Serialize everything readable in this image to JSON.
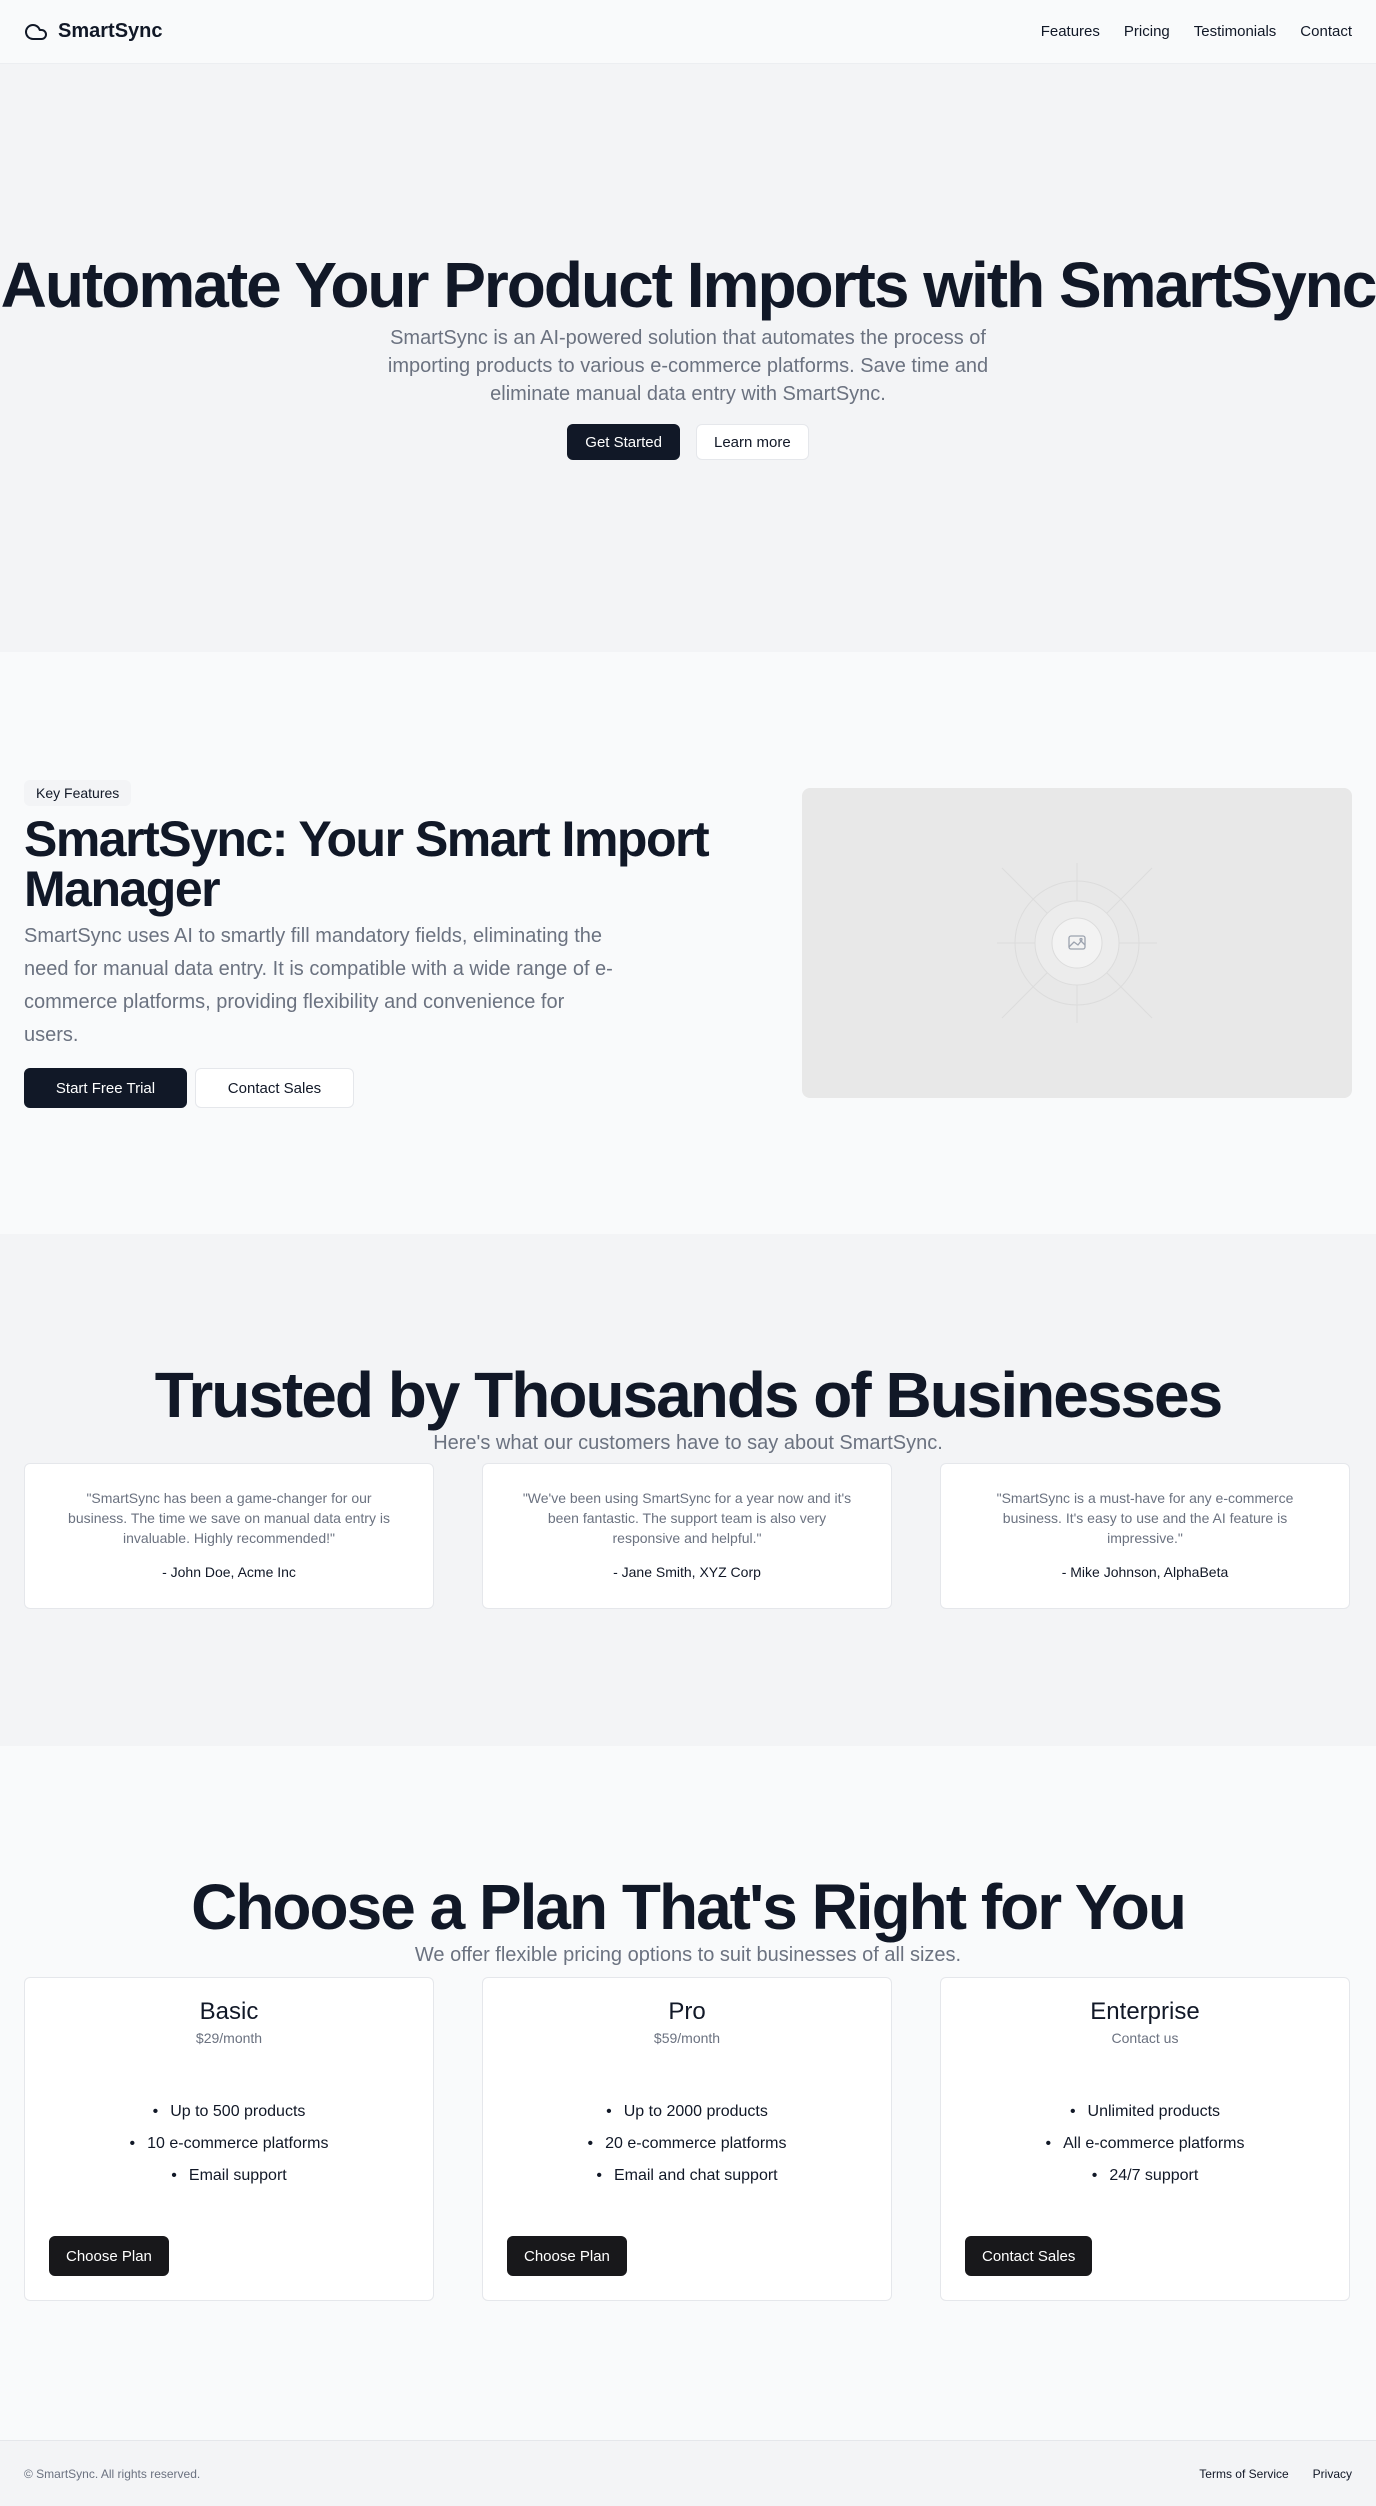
{
  "header": {
    "brand": "SmartSync",
    "nav": [
      "Features",
      "Pricing",
      "Testimonials",
      "Contact"
    ]
  },
  "hero": {
    "title": "Automate Your Product Imports with SmartSync",
    "description": "SmartSync is an AI-powered solution that automates the process of importing products to various e-commerce platforms. Save time and eliminate manual data entry with SmartSync.",
    "primary_button": "Get Started",
    "secondary_button": "Learn more"
  },
  "features": {
    "badge": "Key Features",
    "title": "SmartSync: Your Smart Import Manager",
    "description": "SmartSync uses AI to smartly fill mandatory fields, eliminating the need for manual data entry. It is compatible with a wide range of e-commerce platforms, providing flexibility and convenience for users.",
    "primary_button": "Start Free Trial",
    "secondary_button": "Contact Sales",
    "image_icon": "image-placeholder-icon"
  },
  "testimonials": {
    "title": "Trusted by Thousands of Businesses",
    "subtitle": "Here's what our customers have to say about SmartSync.",
    "items": [
      {
        "quote": "\"SmartSync has been a game-changer for our business. The time we save on manual data entry is invaluable. Highly recommended!\"",
        "author": "- John Doe, Acme Inc"
      },
      {
        "quote": "\"We've been using SmartSync for a year now and it's been fantastic. The support team is also very responsive and helpful.\"",
        "author": "- Jane Smith, XYZ Corp"
      },
      {
        "quote": "\"SmartSync is a must-have for any e-commerce business. It's easy to use and the AI feature is impressive.\"",
        "author": "- Mike Johnson, AlphaBeta"
      }
    ]
  },
  "pricing": {
    "title": "Choose a Plan That's Right for You",
    "subtitle": "We offer flexible pricing options to suit businesses of all sizes.",
    "plans": [
      {
        "name": "Basic",
        "price": "$29/month",
        "features": [
          "Up to 500 products",
          "10 e-commerce platforms",
          "Email support"
        ],
        "button": "Choose Plan"
      },
      {
        "name": "Pro",
        "price": "$59/month",
        "features": [
          "Up to 2000 products",
          "20 e-commerce platforms",
          "Email and chat support"
        ],
        "button": "Choose Plan"
      },
      {
        "name": "Enterprise",
        "price": "Contact us",
        "features": [
          "Unlimited products",
          "All e-commerce platforms",
          "24/7 support"
        ],
        "button": "Contact Sales"
      }
    ]
  },
  "footer": {
    "copyright": "© SmartSync. All rights reserved.",
    "links": [
      "Terms of Service",
      "Privacy"
    ]
  },
  "colors": {
    "primary": "#111827",
    "muted_text": "#6b7280",
    "section_alt_bg": "#f3f4f6",
    "page_bg": "#f9fafb"
  }
}
